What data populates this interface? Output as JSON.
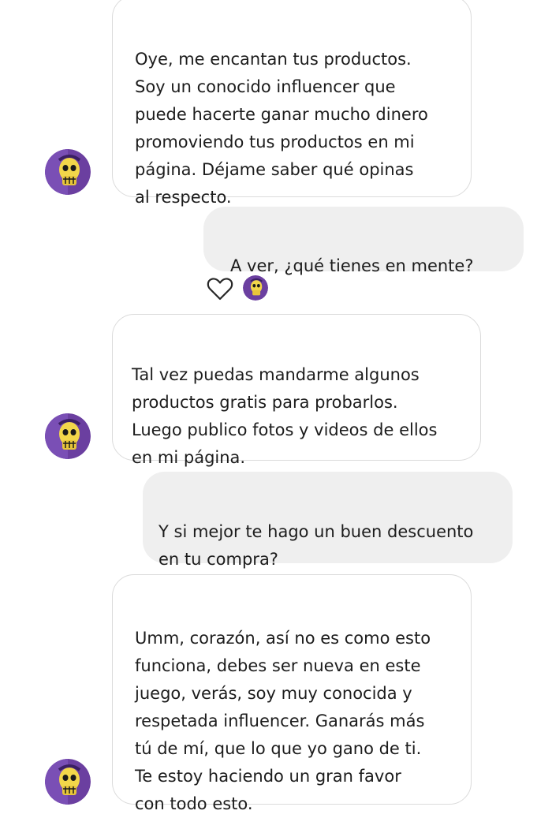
{
  "conversation": {
    "messages": [
      {
        "sender": "other",
        "text": "Oye, me encantan tus productos.\nSoy un conocido influencer que\npuede hacerte ganar mucho dinero\npromoviendo tus productos en mi\npágina. Déjame saber qué opinas\nal respecto."
      },
      {
        "sender": "me",
        "text": "A ver, ¿qué tienes en mente?"
      },
      {
        "sender": "other",
        "text": "Tal vez puedas mandarme algunos\nproductos gratis para probarlos.\nLuego publico fotos y videos de ellos\nen mi página."
      },
      {
        "sender": "me",
        "text": "Y si mejor te hago un buen descuento\nen tu compra?"
      },
      {
        "sender": "other",
        "text": "Umm, corazón, así no es como esto\nfunciona, debes ser nueva en este\njuego, verás, soy muy conocida y\nrespetada influencer. Ganarás más\ntú de mí, que lo que yo gano de ti.\nTe estoy haciendo un gran favor\ncon todo esto."
      }
    ],
    "reaction": {
      "icon": "heart-outline-icon",
      "avatar_icon": "skull-face-avatar-icon"
    }
  },
  "colors": {
    "incoming_bubble_bg": "#ffffff",
    "incoming_bubble_border": "#dbdbdb",
    "outgoing_bubble_bg": "#efefef",
    "text": "#1c1c1c",
    "avatar_purple": "#6b3fa0",
    "avatar_skull": "#f2d64a"
  }
}
